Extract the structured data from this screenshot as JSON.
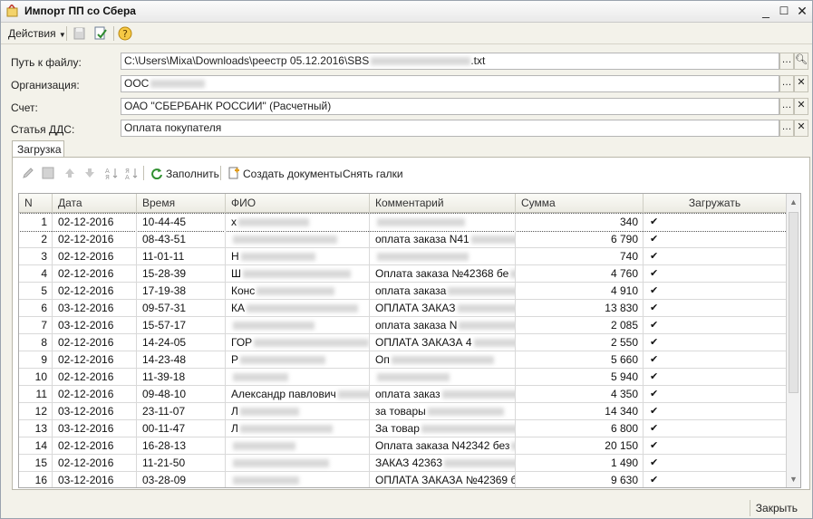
{
  "window": {
    "title": "Импорт ПП со Сбера"
  },
  "toolbar": {
    "actions_label": "Действия"
  },
  "fields": {
    "path": {
      "label": "Путь к файлу:",
      "value": "C:\\Users\\Mixa\\Downloads\\реестр 05.12.2016\\SBS",
      "value_tail": ".txt"
    },
    "org": {
      "label": "Организация:",
      "value": "ООС"
    },
    "account": {
      "label": "Счет:",
      "value": "ОАО \"СБЕРБАНК РОССИИ\" (Расчетный)"
    },
    "dds": {
      "label": "Статья ДДС:",
      "value": "Оплата покупателя"
    }
  },
  "tabs": [
    {
      "label": "Загрузка"
    }
  ],
  "panel_toolbar": {
    "fill_label": "Заполнить",
    "create_docs_label": "Создать документы",
    "uncheck_label": "Снять галки"
  },
  "table": {
    "headers": {
      "n": "N",
      "date": "Дата",
      "time": "Время",
      "fio": "ФИО",
      "comment": "Комментарий",
      "sum": "Сумма",
      "load": "Загружать"
    },
    "rows": [
      {
        "n": "1",
        "date": "02-12-2016",
        "time": "10-44-45",
        "fio": "х",
        "comment": "",
        "sum": "340",
        "load": "✔"
      },
      {
        "n": "2",
        "date": "02-12-2016",
        "time": "08-43-51",
        "fio": "",
        "comment": "оплата заказа N41",
        "sum": "6 790",
        "load": "✔"
      },
      {
        "n": "3",
        "date": "02-12-2016",
        "time": "11-01-11",
        "fio": "Н",
        "comment": "",
        "sum": "740",
        "load": "✔"
      },
      {
        "n": "4",
        "date": "02-12-2016",
        "time": "15-28-39",
        "fio": "Ш",
        "comment": "Оплата заказа №42368 бе",
        "sum": "4 760",
        "load": "✔"
      },
      {
        "n": "5",
        "date": "02-12-2016",
        "time": "17-19-38",
        "fio": "Конс",
        "comment": "оплата заказа",
        "sum": "4 910",
        "load": "✔"
      },
      {
        "n": "6",
        "date": "03-12-2016",
        "time": "09-57-31",
        "fio": "КА",
        "comment": "ОПЛАТА ЗАКАЗ",
        "sum": "13 830",
        "load": "✔"
      },
      {
        "n": "7",
        "date": "03-12-2016",
        "time": "15-57-17",
        "fio": "",
        "comment": "оплата заказа N",
        "sum": "2 085",
        "load": "✔"
      },
      {
        "n": "8",
        "date": "02-12-2016",
        "time": "14-24-05",
        "fio": "ГОР",
        "comment": "ОПЛАТА ЗАКАЗА 4",
        "sum": "2 550",
        "load": "✔"
      },
      {
        "n": "9",
        "date": "02-12-2016",
        "time": "14-23-48",
        "fio": "Р",
        "comment": "Оп",
        "sum": "5 660",
        "load": "✔"
      },
      {
        "n": "10",
        "date": "02-12-2016",
        "time": "11-39-18",
        "fio": "",
        "comment": "",
        "sum": "5 940",
        "load": "✔"
      },
      {
        "n": "11",
        "date": "02-12-2016",
        "time": "09-48-10",
        "fio": "Александр павлович",
        "comment": "оплата заказ",
        "sum": "4 350",
        "load": "✔"
      },
      {
        "n": "12",
        "date": "03-12-2016",
        "time": "23-11-07",
        "fio": "Л",
        "comment": "за товары",
        "sum": "14 340",
        "load": "✔"
      },
      {
        "n": "13",
        "date": "03-12-2016",
        "time": "00-11-47",
        "fio": "Л",
        "comment": "За товар",
        "sum": "6 800",
        "load": "✔"
      },
      {
        "n": "14",
        "date": "02-12-2016",
        "time": "16-28-13",
        "fio": "",
        "comment": "Оплата заказа N42342 без",
        "sum": "20 150",
        "load": "✔"
      },
      {
        "n": "15",
        "date": "02-12-2016",
        "time": "11-21-50",
        "fio": "",
        "comment": "ЗАКАЗ 42363",
        "sum": "1 490",
        "load": "✔"
      },
      {
        "n": "16",
        "date": "03-12-2016",
        "time": "03-28-09",
        "fio": "",
        "comment": "ОПЛАТА ЗАКАЗА №42369 б",
        "sum": "9 630",
        "load": "✔"
      }
    ]
  },
  "footer": {
    "close_label": "Закрыть"
  }
}
